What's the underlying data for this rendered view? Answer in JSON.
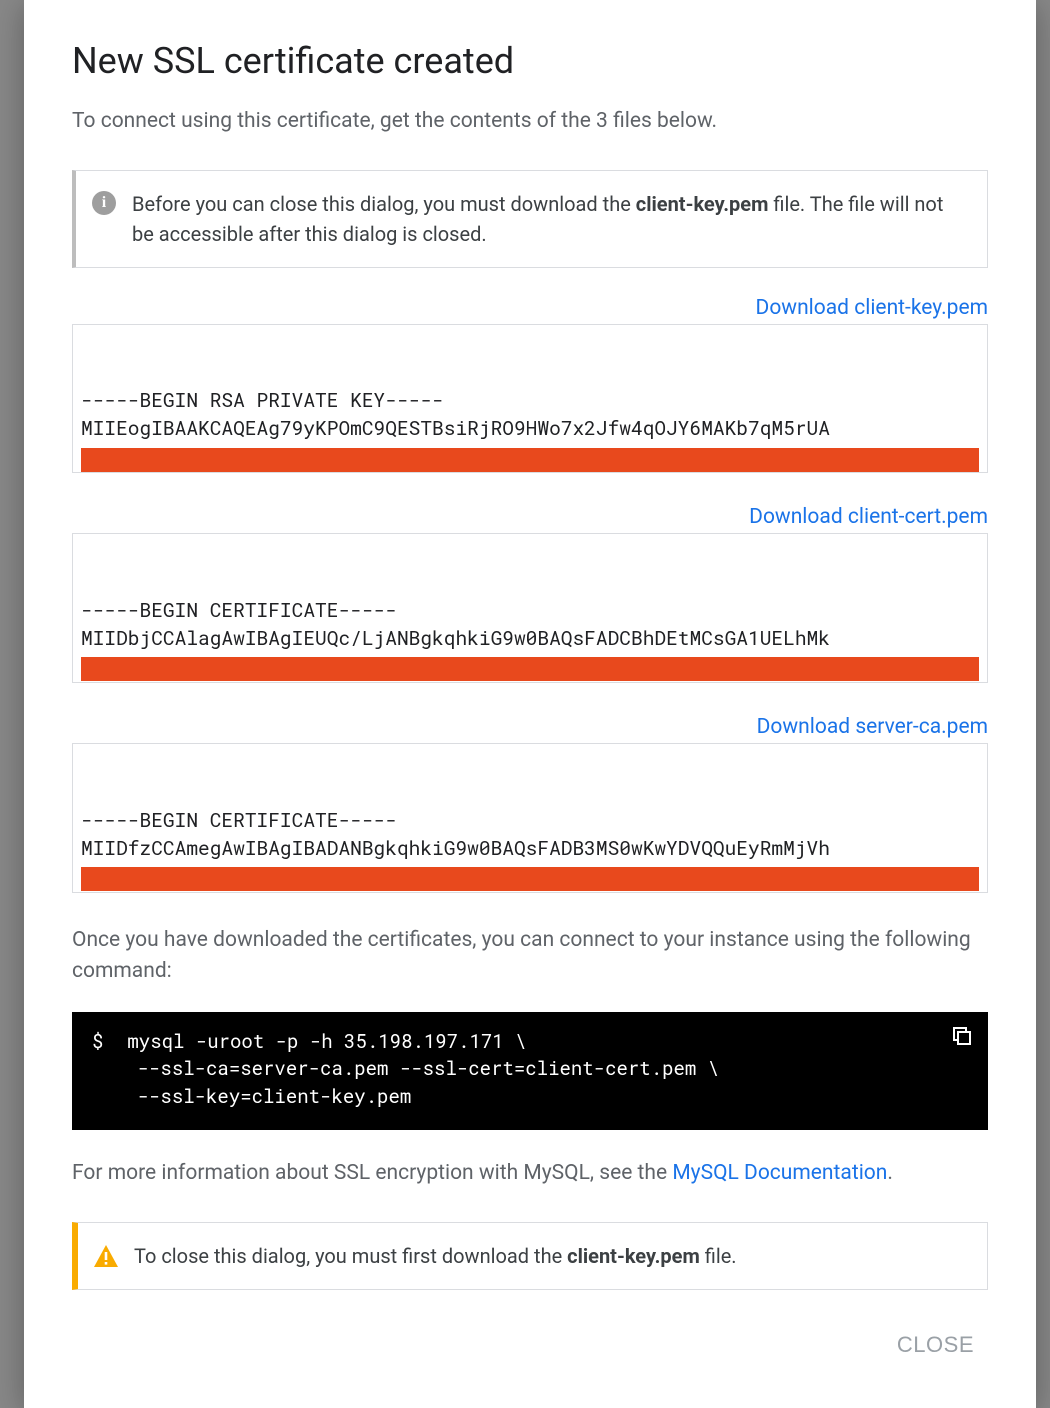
{
  "dialog": {
    "title": "New SSL certificate created",
    "intro": "To connect using this certificate, get the contents of the 3 files below.",
    "info_notice": {
      "prefix": "Before you can close this dialog, you must download the ",
      "bold": "client-key.pem",
      "suffix": " file. The file will not be accessible after this dialog is closed."
    },
    "files": [
      {
        "download_label": "Download client-key.pem",
        "line1": "-----BEGIN RSA PRIVATE KEY-----",
        "line2": "MIIEogIBAAKCAQEAg79yKPOmC9QESTBsiRjRO9HWo7x2Jfw4qOJY6MAKb7qM5rUA"
      },
      {
        "download_label": "Download client-cert.pem",
        "line1": "-----BEGIN CERTIFICATE-----",
        "line2": "MIIDbjCCAlagAwIBAgIEUQc/LjANBgkqhkiG9w0BAQsFADCBhDEtMCsGA1UELhMk"
      },
      {
        "download_label": "Download server-ca.pem",
        "line1": "-----BEGIN CERTIFICATE-----",
        "line2": "MIIDfzCCAmegAwIBAgIBADANBgkqhkiG9w0BAQsFADB3MS0wKwYDVQQuEyRmMjVh"
      }
    ],
    "post_download_text": "Once you have downloaded the certificates, you can connect to your instance using the following command:",
    "command": {
      "prompt": "$",
      "text": "mysql -uroot -p -h 35.198.197.171 \\\n    --ssl-ca=server-ca.pem --ssl-cert=client-cert.pem \\\n    --ssl-key=client-key.pem"
    },
    "more_info": {
      "prefix": "For more information about SSL encryption with MySQL, see the ",
      "link_text": "MySQL Documentation",
      "suffix": "."
    },
    "warn_notice": {
      "prefix": "To close this dialog, you must first download the ",
      "bold": "client-key.pem",
      "suffix": " file."
    },
    "close_label": "CLOSE"
  }
}
